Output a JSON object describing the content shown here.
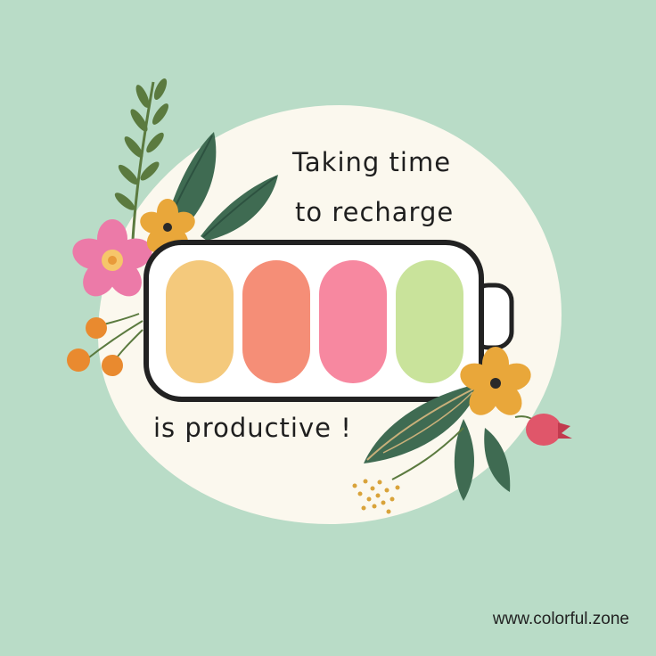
{
  "headline": {
    "line1": "Taking time",
    "line2": "to recharge",
    "line3": "is productive !"
  },
  "website": "www.colorful.zone",
  "battery": {
    "cells": [
      "#f4c97c",
      "#f58e77",
      "#f788a0",
      "#c9e39b"
    ],
    "outline": "#222222",
    "body": "#ffffff"
  },
  "colors": {
    "background": "#b9dcc7",
    "blob": "#fbf8ee",
    "leaf": "#3f6b52",
    "olive_leaf": "#5b7a3f",
    "pink_flower": "#ec7aa8",
    "yellow_flower": "#e9a73a",
    "berry": "#e98a2f",
    "red_berry": "#e0566a"
  },
  "decorations": {
    "left_bouquet": [
      "fern-branch-icon",
      "leaf-icon",
      "pink-flower-icon",
      "yellow-flower-icon",
      "orange-berries-icon"
    ],
    "right_bouquet": [
      "yellow-flower-icon",
      "red-rosehip-icon",
      "leaf-icon",
      "pollen-dots-icon"
    ]
  }
}
